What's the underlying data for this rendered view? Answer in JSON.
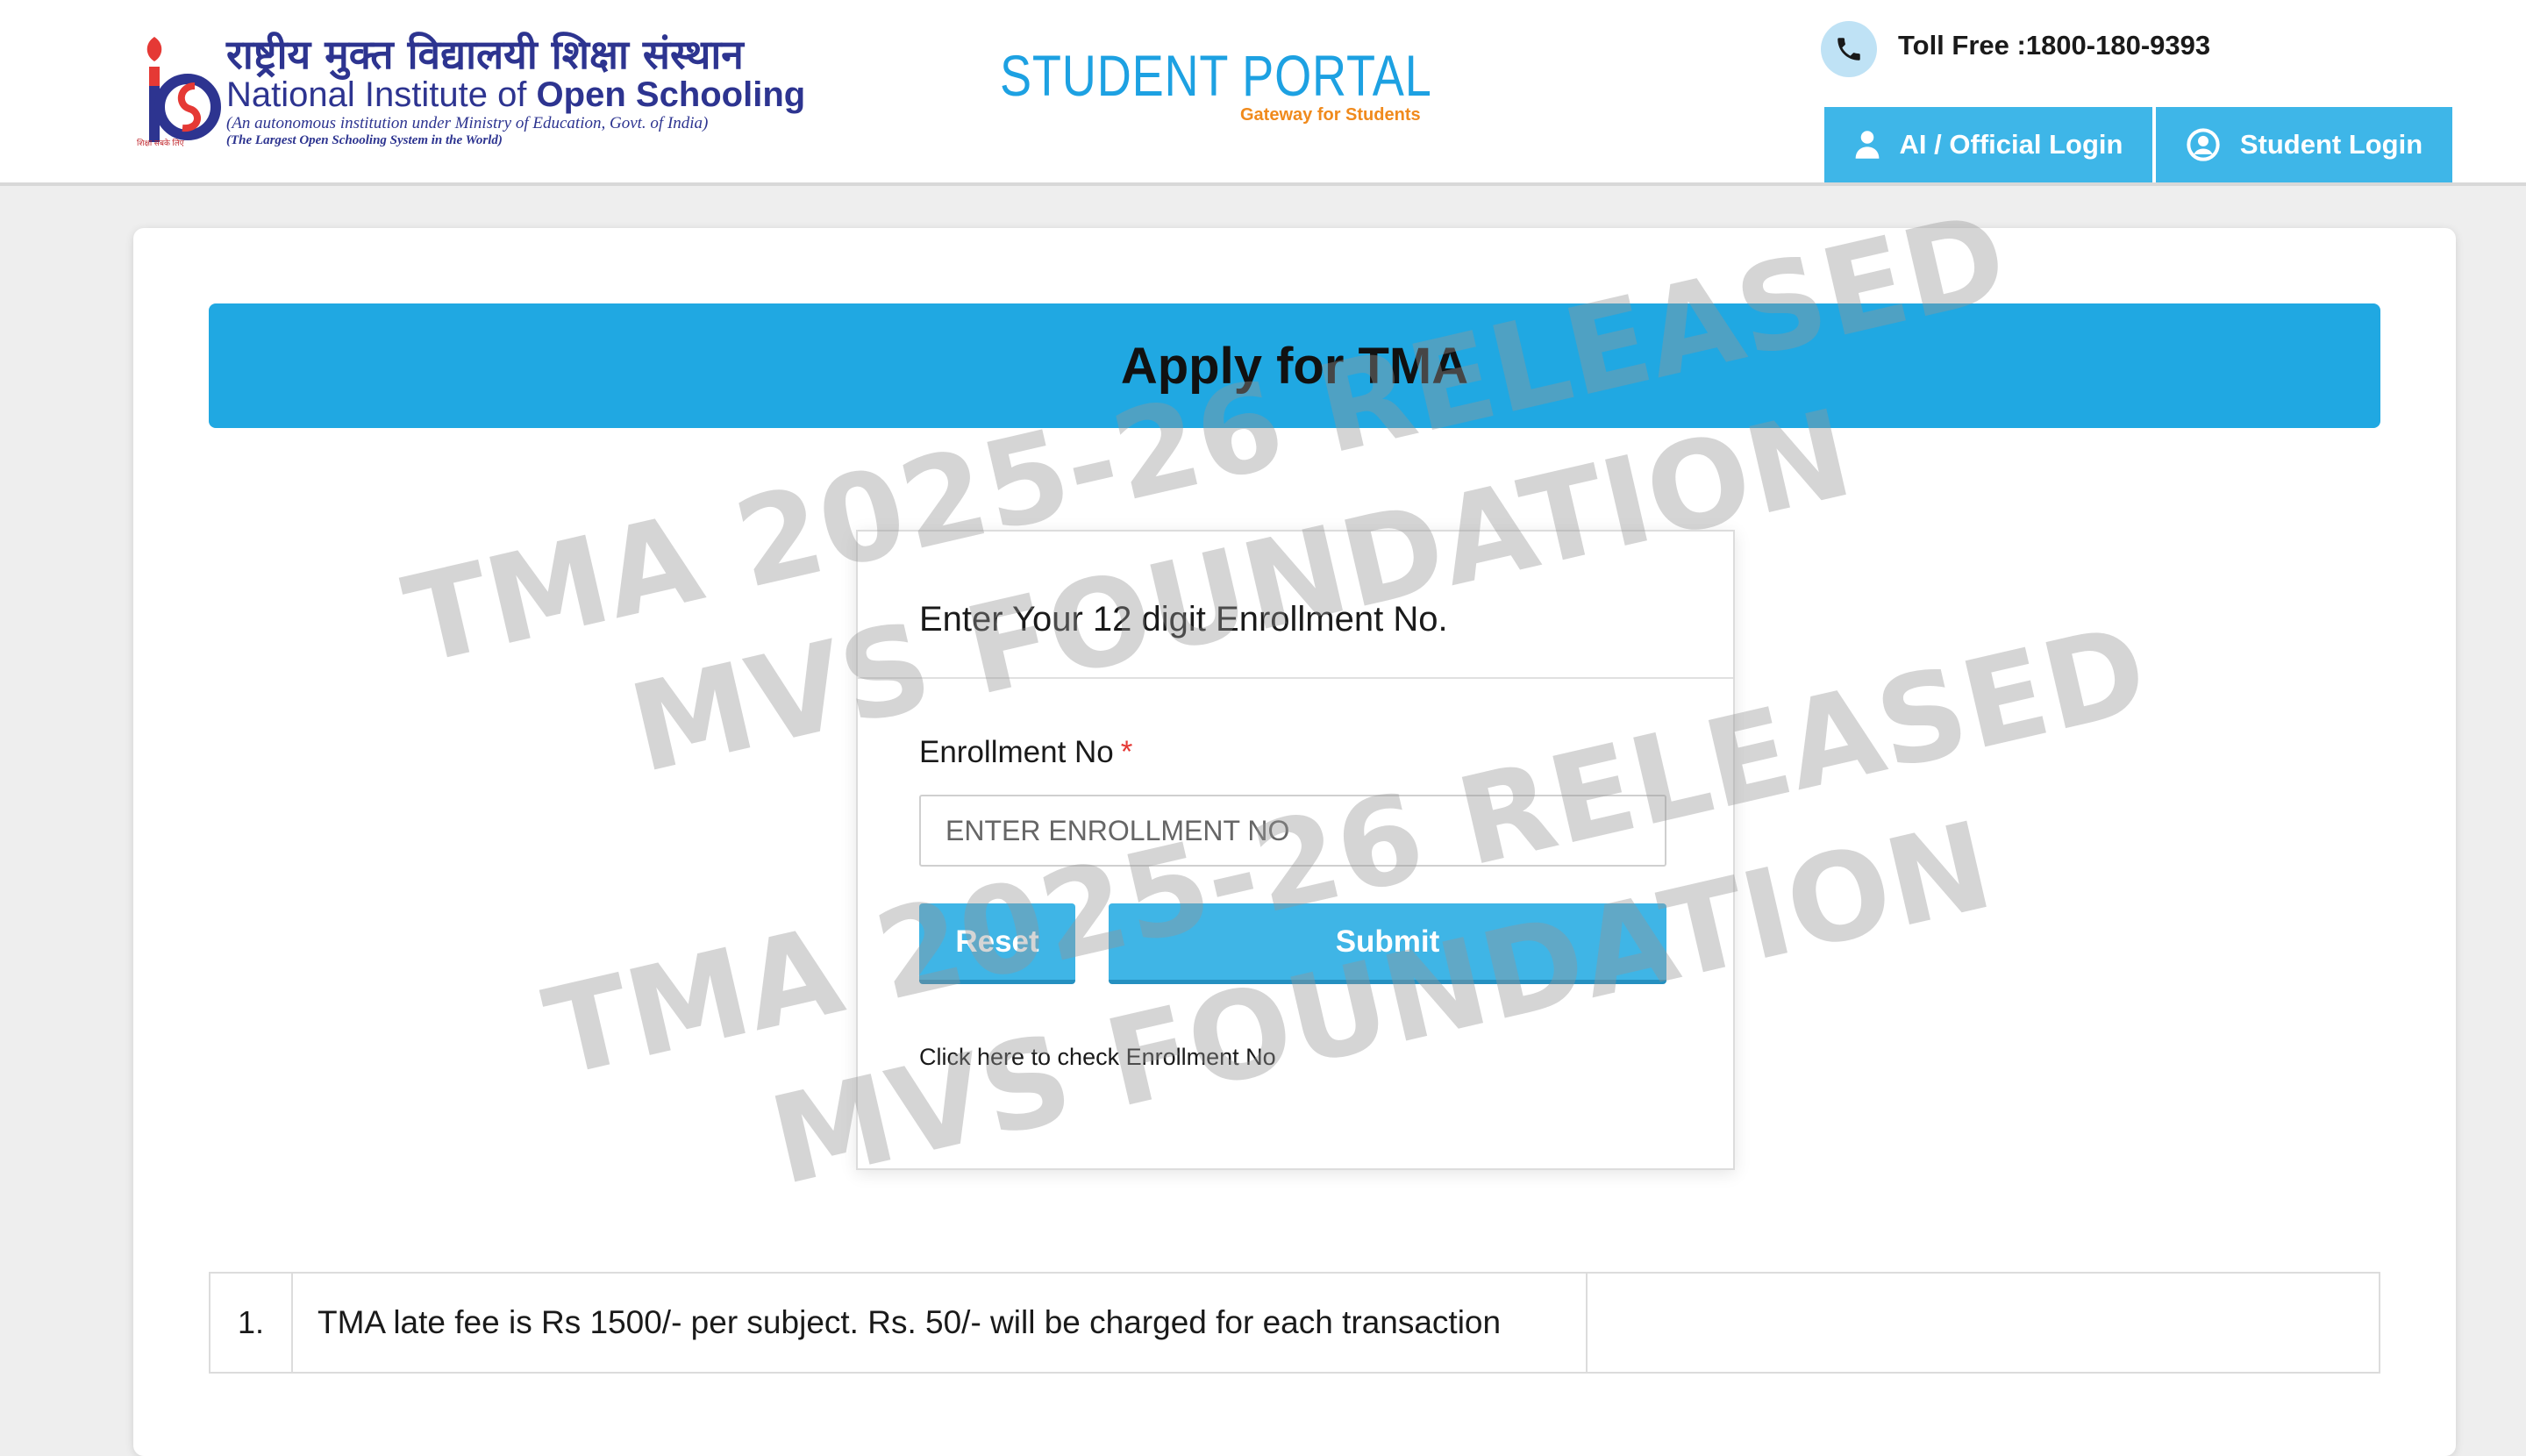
{
  "header": {
    "logo": {
      "hindi": "राष्ट्रीय मुक्त विद्यालयी शिक्षा संस्थान",
      "english_light": "National Institute of",
      "english_bold": "Open Schooling",
      "sub1": "(An autonomous institution under Ministry of Education, Govt. of India)",
      "sub2": "(The Largest Open Schooling System in the World)",
      "tagline": "शिक्षा सबके लिए"
    },
    "portal_title": "STUDENT PORTAL",
    "portal_subtitle": "Gateway for Students",
    "toll_free": "Toll Free :1800-180-9393",
    "login_buttons": {
      "official": "AI / Official Login",
      "student": "Student Login"
    }
  },
  "main": {
    "banner_title": "Apply for TMA",
    "form": {
      "title": "Enter Your 12 digit Enrollment No.",
      "field_label": "Enrollment No",
      "required_mark": "*",
      "input_value": "",
      "input_placeholder": "ENTER ENROLLMENT NO",
      "reset_label": "Reset",
      "submit_label": "Submit",
      "check_link": "Click here to check Enrollment No"
    },
    "notes": [
      {
        "num": "1.",
        "text": "TMA late fee is Rs 1500/- per subject. Rs. 50/- will be charged for each transaction"
      }
    ]
  },
  "watermark": {
    "line1": "TMA 2025-26 RELEASED",
    "line2": "MVS FOUNDATION"
  },
  "colors": {
    "accent": "#20a8e2",
    "button": "#3fb5e6",
    "brand_navy": "#2d3490",
    "brand_orange": "#f08a1c",
    "required": "#e53935"
  }
}
